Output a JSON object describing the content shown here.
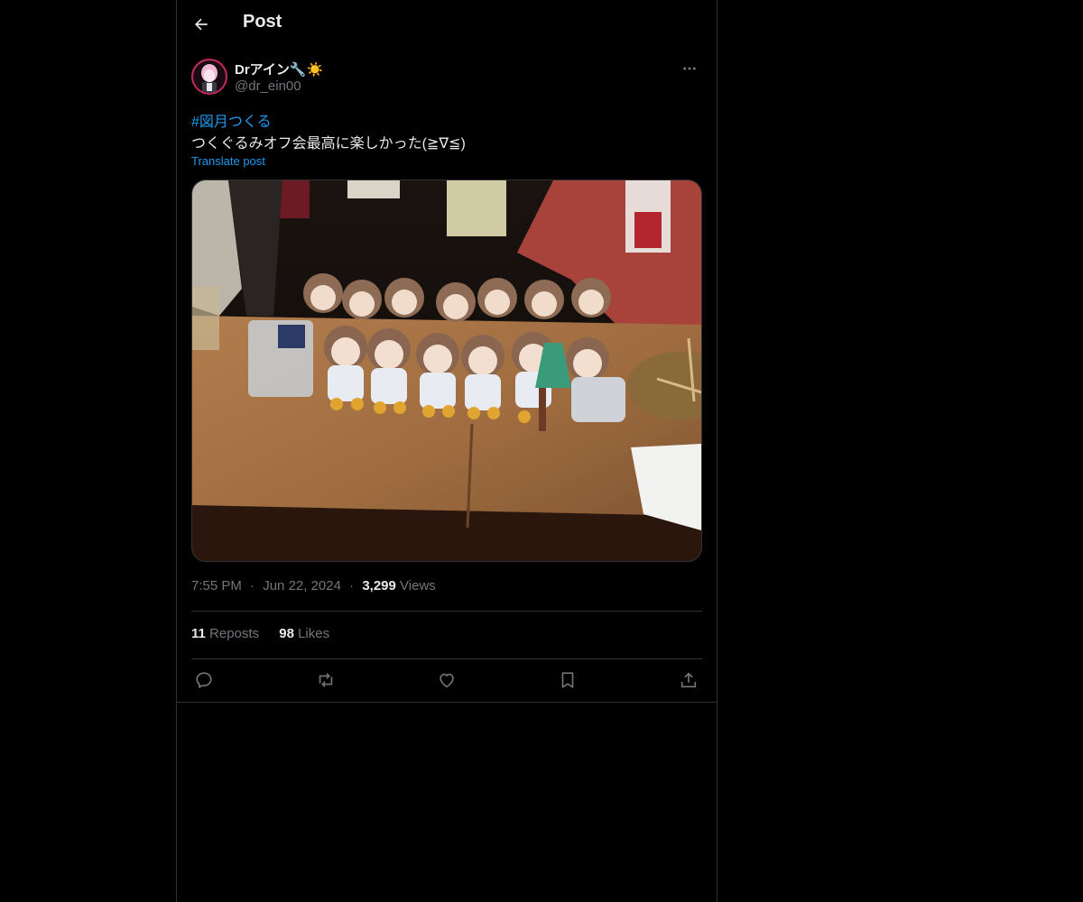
{
  "header": {
    "title": "Post",
    "back_icon": "arrow-left-icon"
  },
  "author": {
    "display_name": "Drアイン🔧☀️",
    "handle": "@dr_ein00",
    "more_icon": "more-horizontal-icon"
  },
  "post": {
    "hashtag": "#図月つくる",
    "text": "つくぐるみオフ会最高に楽しかった(≧∇≦)",
    "translate_label": "Translate post",
    "time": "7:55 PM",
    "separator": "·",
    "date": "Jun 22, 2024",
    "views_count": "3,299",
    "views_label": "Views"
  },
  "stats": {
    "reposts_count": "11",
    "reposts_label": "Reposts",
    "likes_count": "98",
    "likes_label": "Likes"
  },
  "actions": [
    {
      "name": "reply",
      "icon": "reply-icon"
    },
    {
      "name": "repost",
      "icon": "repost-icon"
    },
    {
      "name": "like",
      "icon": "heart-icon"
    },
    {
      "name": "bookmark",
      "icon": "bookmark-icon"
    },
    {
      "name": "share",
      "icon": "share-icon"
    }
  ],
  "colors": {
    "background": "#000000",
    "text": "#e7e9ea",
    "muted": "#71767b",
    "link": "#1d9bf0",
    "border": "#2f3336"
  }
}
